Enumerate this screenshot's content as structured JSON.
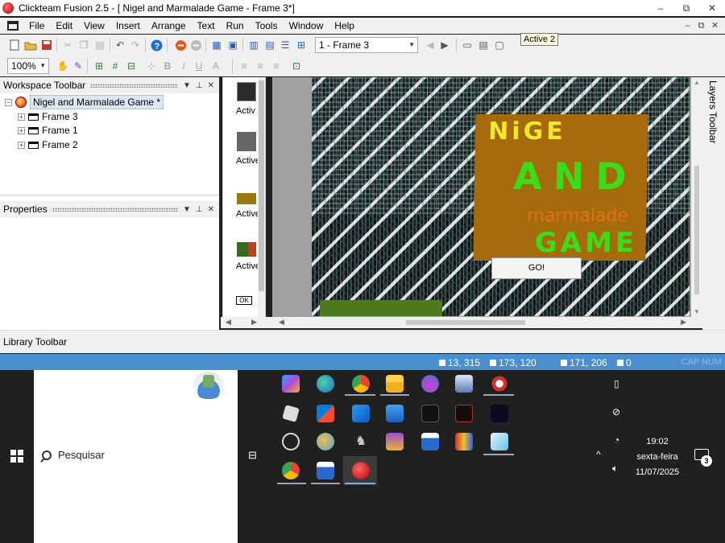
{
  "window": {
    "title": "Clickteam Fusion 2.5 - [ Nigel and Marmalade Game - Frame 3*]",
    "controls": [
      "–",
      "⧉",
      "✕"
    ]
  },
  "menu": {
    "items": [
      "File",
      "Edit",
      "View",
      "Insert",
      "Arrange",
      "Text",
      "Run",
      "Tools",
      "Window",
      "Help"
    ],
    "mdi_controls": [
      "–",
      "⧉",
      "✕"
    ]
  },
  "toolbar": {
    "frame_select": "1 - Frame 3",
    "zoom": "100%",
    "tooltip": "Active 2"
  },
  "workspace": {
    "title": "Workspace Toolbar",
    "app_name": "Nigel and Marmalade Game *",
    "frames": [
      "Frame 3",
      "Frame 1",
      "Frame 2"
    ]
  },
  "properties": {
    "title": "Properties"
  },
  "objects": [
    {
      "label": "Activ",
      "color": "#2b2b2b"
    },
    {
      "label": "Active",
      "color": "#666666"
    },
    {
      "label": "Active",
      "color": "#9a7a10"
    },
    {
      "label": "Active",
      "color": "#3a6a20"
    },
    {
      "label": "OK",
      "color": "#ffffff"
    }
  ],
  "canvas": {
    "title_line1": "NiGE",
    "title_line2": "AND",
    "title_line3": "marmalade",
    "title_line4": "GAME",
    "go_button": "GO!",
    "colors": {
      "sign": "#a56b0c",
      "yellow": "#f5e82a",
      "green": "#3ddc1a",
      "orange": "#e0701a"
    }
  },
  "layers": {
    "title": "Layers Toolbar"
  },
  "library": {
    "title": "Library Toolbar"
  },
  "status": {
    "pos1": "13, 315",
    "pos2": "173, 120",
    "pos3": "171, 206",
    "count": "0",
    "caps": "CAP  NUM"
  },
  "taskbar": {
    "search_placeholder": "Pesquisar",
    "time": "19:02",
    "day": "sexta-feira",
    "date": "11/07/2025",
    "notifications": "3"
  }
}
